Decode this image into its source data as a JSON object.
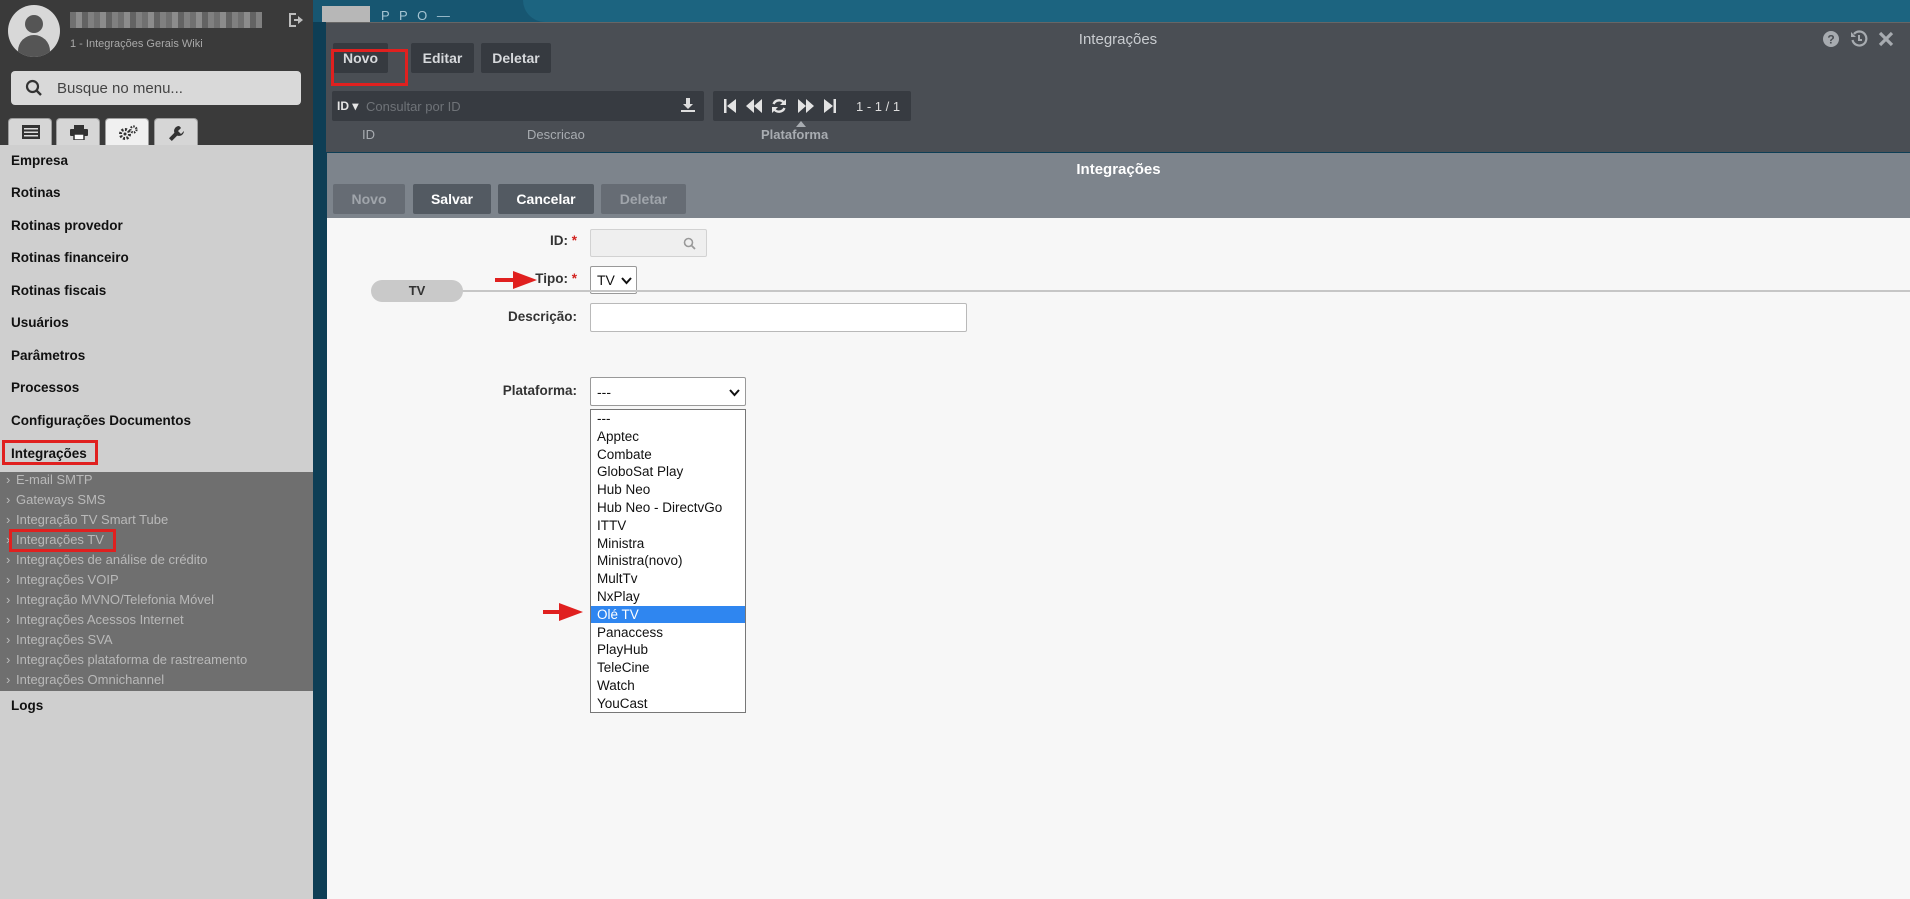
{
  "sidebar": {
    "user_subtitle": "1 - Integrações Gerais Wiki",
    "search_placeholder": "Busque no menu...",
    "menu": [
      "Empresa",
      "Rotinas",
      "Rotinas provedor",
      "Rotinas financeiro",
      "Rotinas fiscais",
      "Usuários",
      "Parâmetros",
      "Processos",
      "Configurações Documentos",
      "Integrações"
    ],
    "submenu": [
      "E-mail SMTP",
      "Gateways SMS",
      "Integração TV Smart Tube",
      "Integrações TV",
      "Integrações de análise de crédito",
      "Integrações VOIP",
      "Integração MVNO/Telefonia Móvel",
      "Integrações Acessos Internet",
      "Integrações SVA",
      "Integrações plataforma de rastreamento",
      "Integrações Omnichannel"
    ],
    "logs": "Logs"
  },
  "top_tab_text": "P P O —",
  "list_window": {
    "title": "Integrações",
    "buttons": {
      "new": "Novo",
      "edit": "Editar",
      "delete": "Deletar"
    },
    "filter_field": "ID",
    "filter_placeholder": "Consultar por ID",
    "pager_text": "1 - 1 / 1",
    "columns": [
      "ID",
      "Descricao",
      "Plataforma"
    ]
  },
  "form_window": {
    "title": "Integrações",
    "buttons": {
      "new": "Novo",
      "save": "Salvar",
      "cancel": "Cancelar",
      "delete": "Deletar"
    },
    "labels": {
      "id": "ID:",
      "tipo": "Tipo:",
      "descricao": "Descrição:",
      "plataforma": "Plataforma:"
    },
    "required_mark": "*",
    "tipo_value": "TV",
    "section": "TV",
    "plataforma_value": "---",
    "plataforma_options": [
      "---",
      "Apptec",
      "Combate",
      "GloboSat Play",
      "Hub Neo",
      "Hub Neo - DirectvGo",
      "ITTV",
      "Ministra",
      "Ministra(novo)",
      "MultTv",
      "NxPlay",
      "Olé TV",
      "Panaccess",
      "PlayHub",
      "TeleCine",
      "Watch",
      "YouCast"
    ],
    "highlighted_option": "Olé TV"
  },
  "colors": {
    "highlight_box": "#e0201f",
    "selected_option": "#2f86f0",
    "arrow": "#e0201f"
  }
}
